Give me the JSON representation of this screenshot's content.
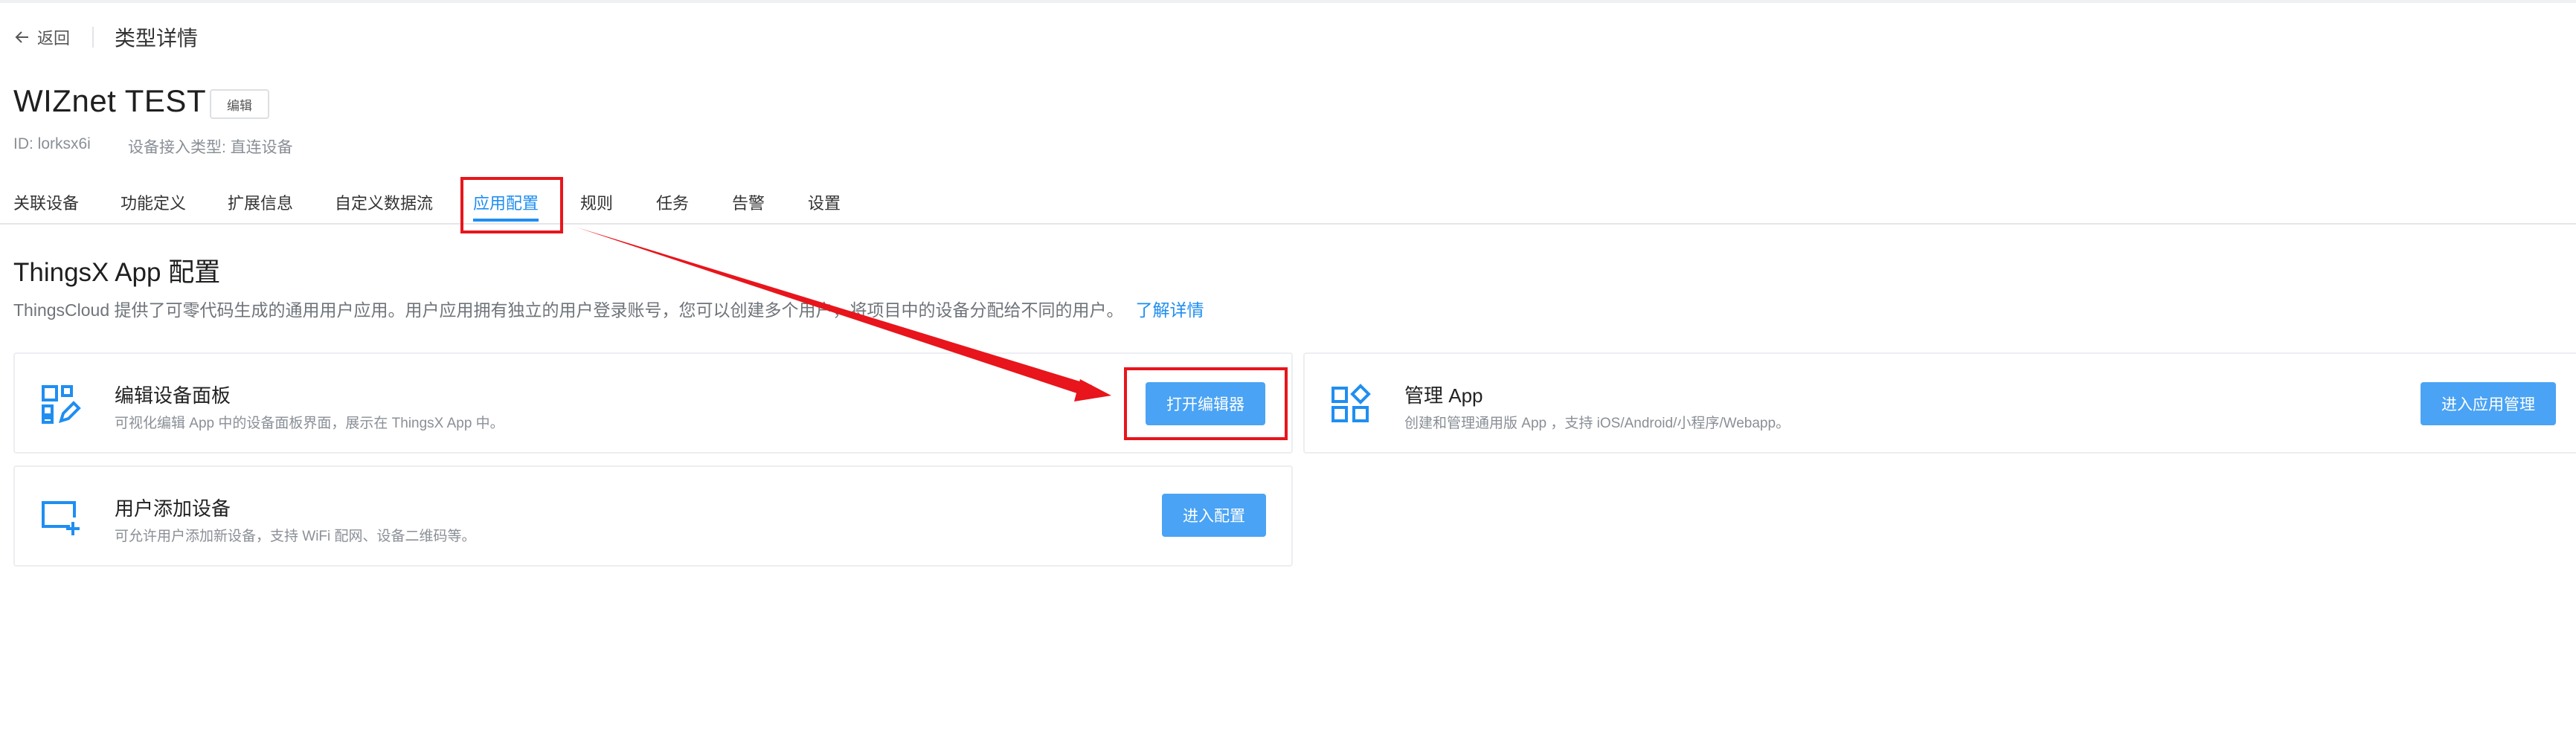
{
  "header": {
    "back_label": "返回",
    "page_title": "类型详情"
  },
  "device": {
    "name": "WIZnet TEST",
    "edit_label": "编辑",
    "id_text": "ID: lorksx6i",
    "access_type_text": "设备接入类型: 直连设备"
  },
  "tabs": [
    {
      "label": "关联设备",
      "active": false
    },
    {
      "label": "功能定义",
      "active": false
    },
    {
      "label": "扩展信息",
      "active": false
    },
    {
      "label": "自定义数据流",
      "active": false
    },
    {
      "label": "应用配置",
      "active": true
    },
    {
      "label": "规则",
      "active": false
    },
    {
      "label": "任务",
      "active": false
    },
    {
      "label": "告警",
      "active": false
    },
    {
      "label": "设置",
      "active": false
    }
  ],
  "section": {
    "title": "ThingsX App 配置",
    "description": "ThingsCloud 提供了可零代码生成的通用用户应用。用户应用拥有独立的用户登录账号，您可以创建多个用户，将项目中的设备分配给不同的用户。",
    "link_label": "了解详情"
  },
  "cards": [
    {
      "title": "编辑设备面板",
      "description": "可视化编辑 App 中的设备面板界面，展示在 ThingsX App 中。",
      "button_label": "打开编辑器",
      "icon": "dashboard-edit-icon"
    },
    {
      "title": "管理 App",
      "description": "创建和管理通用版 App ，支持 iOS/Android/小程序/Webapp。",
      "button_label": "进入应用管理",
      "icon": "apps-grid-icon"
    },
    {
      "title": "用户添加设备",
      "description": "可允许用户添加新设备，支持 WiFi 配网、设备二维码等。",
      "button_label": "进入配置",
      "icon": "add-device-icon"
    }
  ],
  "colors": {
    "accent": "#1f8ef1",
    "button": "#4aa3f4",
    "annotation": "#e8151c"
  }
}
